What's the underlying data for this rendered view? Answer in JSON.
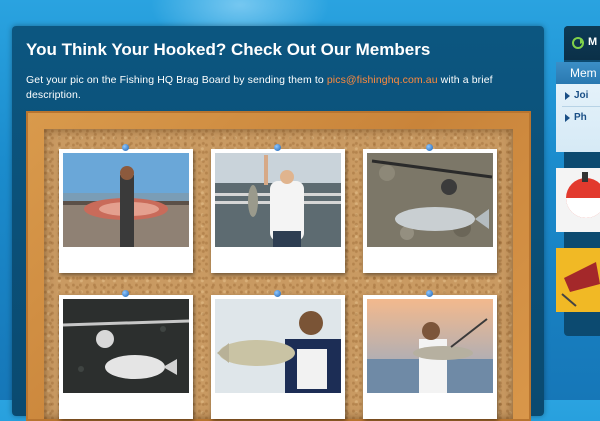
{
  "heading": "You Think Your Hooked? Check Out Our Members",
  "intro": {
    "before": "Get your pic on the Fishing HQ Brag Board by sending them to ",
    "email": "pics@fishinghq.com.au",
    "after": " with a brief description."
  },
  "board": {
    "photos": [
      {
        "name": "photo-1",
        "subject": "man holding snapper on jetty"
      },
      {
        "name": "photo-2",
        "subject": "woman holding fish on pier"
      },
      {
        "name": "photo-3",
        "subject": "fish on rocks with rod and reel"
      },
      {
        "name": "photo-4",
        "subject": "bream with rod on dark ground"
      },
      {
        "name": "photo-5",
        "subject": "man holding barramundi"
      },
      {
        "name": "photo-6",
        "subject": "man holding fish at sunset"
      }
    ]
  },
  "sidebar": {
    "tab_label": "M",
    "box_title": "Mem",
    "links": [
      "Joi",
      "Ph"
    ]
  },
  "colors": {
    "background": "#1b8ccd",
    "panel": "#0b4f78",
    "email": "#ff8a3d",
    "frame": "#c9843a"
  }
}
